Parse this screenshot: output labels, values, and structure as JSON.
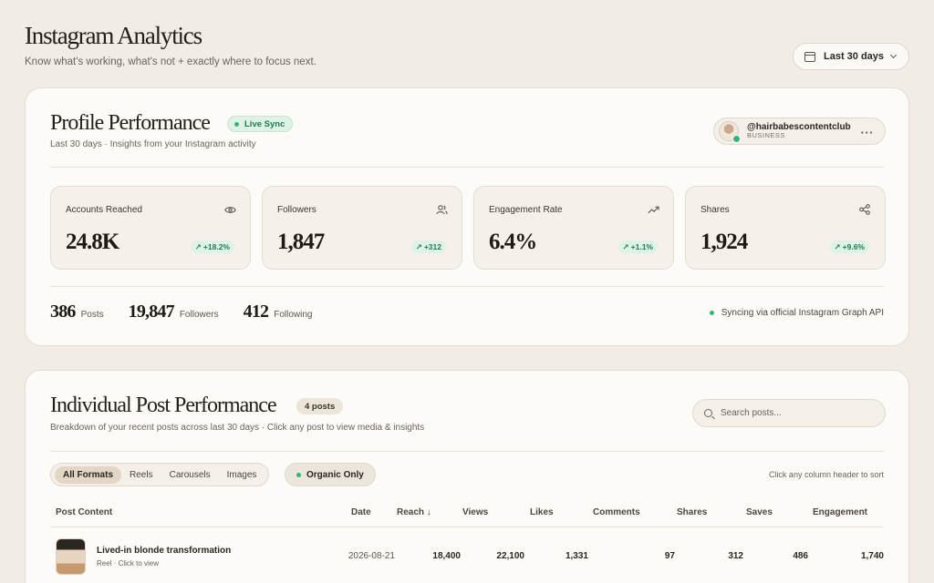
{
  "header": {
    "title": "Instagram Analytics",
    "subtitle": "Know what's working, what's not + exactly where to focus next.",
    "date_range": "Last 30 days"
  },
  "profile": {
    "title": "Profile Performance",
    "live_badge": "Live Sync",
    "subtitle": "Last 30 days · Insights from your Instagram activity",
    "account": {
      "handle": "@hairbabescontentclub",
      "type": "BUSINESS",
      "more": "···"
    },
    "stats": [
      {
        "label": "Accounts Reached",
        "value": "24.8K",
        "delta": "+18.2%",
        "icon": "eye-icon"
      },
      {
        "label": "Followers",
        "value": "1,847",
        "delta": "+312",
        "icon": "users-icon"
      },
      {
        "label": "Engagement Rate",
        "value": "6.4%",
        "delta": "+1.1%",
        "icon": "trending-up-icon"
      },
      {
        "label": "Shares",
        "value": "1,924",
        "delta": "+9.6%",
        "icon": "share-icon"
      }
    ],
    "counts": [
      {
        "value": "386",
        "label": "Posts"
      },
      {
        "value": "19,847",
        "label": "Followers"
      },
      {
        "value": "412",
        "label": "Following"
      }
    ],
    "sync_note": "Syncing via official Instagram Graph API"
  },
  "posts": {
    "title": "Individual Post Performance",
    "count_badge": "4 posts",
    "subtitle": "Breakdown of your recent posts across last 30 days · Click any post to view media & insights",
    "search_placeholder": "Search posts...",
    "filters": [
      "All Formats",
      "Reels",
      "Carousels",
      "Images"
    ],
    "organic": "Organic Only",
    "sort_hint": "Click any column header to sort",
    "columns": [
      "Post Content",
      "Date",
      "Reach ↓",
      "Views",
      "Likes",
      "Comments",
      "Shares",
      "Saves",
      "Engagement"
    ],
    "rows": [
      {
        "title": "Lived-in blonde transformation",
        "sub": "Reel · Click to view",
        "date": "2026-08-21",
        "reach": "18,400",
        "views": "22,100",
        "likes": "1,331",
        "comments": "97",
        "shares": "312",
        "saves": "486",
        "engagement": "1,740"
      }
    ]
  },
  "colors": {
    "accent_green": "#35b477",
    "background": "#f1ece6",
    "card": "#fdfbf7"
  }
}
